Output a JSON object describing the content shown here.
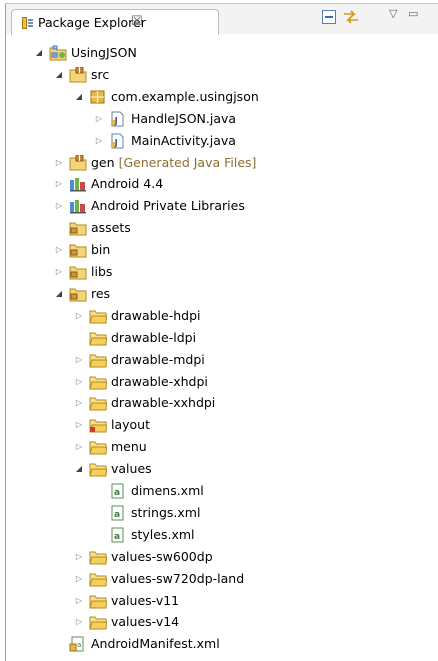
{
  "view": {
    "title": "Package Explorer",
    "close_glyph": "☒",
    "toolbar": [
      {
        "name": "collapse-all-icon"
      },
      {
        "name": "link-with-editor-icon"
      },
      {
        "name": "view-menu-icon",
        "glyph": "▽"
      },
      {
        "name": "minimize-icon",
        "glyph": "▭"
      }
    ]
  },
  "tree": [
    {
      "label": "UsingJSON",
      "depth": 0,
      "exp": "open",
      "icon": "project"
    },
    {
      "label": "src",
      "depth": 1,
      "exp": "open",
      "icon": "srcfolder"
    },
    {
      "label": "com.example.usingjson",
      "depth": 2,
      "exp": "open",
      "icon": "package"
    },
    {
      "label": "HandleJSON.java",
      "depth": 3,
      "exp": "closed",
      "icon": "java"
    },
    {
      "label": "MainActivity.java",
      "depth": 3,
      "exp": "closed",
      "icon": "java"
    },
    {
      "label": "gen",
      "decoration": "[Generated Java Files]",
      "depth": 1,
      "exp": "closed",
      "icon": "srcfolder"
    },
    {
      "label": "Android 4.4",
      "depth": 1,
      "exp": "closed",
      "icon": "library"
    },
    {
      "label": "Android Private Libraries",
      "depth": 1,
      "exp": "closed",
      "icon": "library"
    },
    {
      "label": "assets",
      "depth": 1,
      "exp": "none",
      "icon": "folder-pkg"
    },
    {
      "label": "bin",
      "depth": 1,
      "exp": "closed",
      "icon": "folder-pkg"
    },
    {
      "label": "libs",
      "depth": 1,
      "exp": "closed",
      "icon": "folder-pkg"
    },
    {
      "label": "res",
      "depth": 1,
      "exp": "open",
      "icon": "folder-pkg"
    },
    {
      "label": "drawable-hdpi",
      "depth": 2,
      "exp": "closed",
      "icon": "folder"
    },
    {
      "label": "drawable-ldpi",
      "depth": 2,
      "exp": "none",
      "icon": "folder"
    },
    {
      "label": "drawable-mdpi",
      "depth": 2,
      "exp": "closed",
      "icon": "folder"
    },
    {
      "label": "drawable-xhdpi",
      "depth": 2,
      "exp": "closed",
      "icon": "folder"
    },
    {
      "label": "drawable-xxhdpi",
      "depth": 2,
      "exp": "closed",
      "icon": "folder"
    },
    {
      "label": "layout",
      "depth": 2,
      "exp": "closed",
      "icon": "folder-error"
    },
    {
      "label": "menu",
      "depth": 2,
      "exp": "closed",
      "icon": "folder"
    },
    {
      "label": "values",
      "depth": 2,
      "exp": "open",
      "icon": "folder"
    },
    {
      "label": "dimens.xml",
      "depth": 3,
      "exp": "none",
      "icon": "xml"
    },
    {
      "label": "strings.xml",
      "depth": 3,
      "exp": "none",
      "icon": "xml"
    },
    {
      "label": "styles.xml",
      "depth": 3,
      "exp": "none",
      "icon": "xml"
    },
    {
      "label": "values-sw600dp",
      "depth": 2,
      "exp": "closed",
      "icon": "folder"
    },
    {
      "label": "values-sw720dp-land",
      "depth": 2,
      "exp": "closed",
      "icon": "folder"
    },
    {
      "label": "values-v11",
      "depth": 2,
      "exp": "closed",
      "icon": "folder"
    },
    {
      "label": "values-v14",
      "depth": 2,
      "exp": "closed",
      "icon": "folder"
    },
    {
      "label": "AndroidManifest.xml",
      "depth": 1,
      "exp": "none",
      "icon": "manifest"
    }
  ]
}
